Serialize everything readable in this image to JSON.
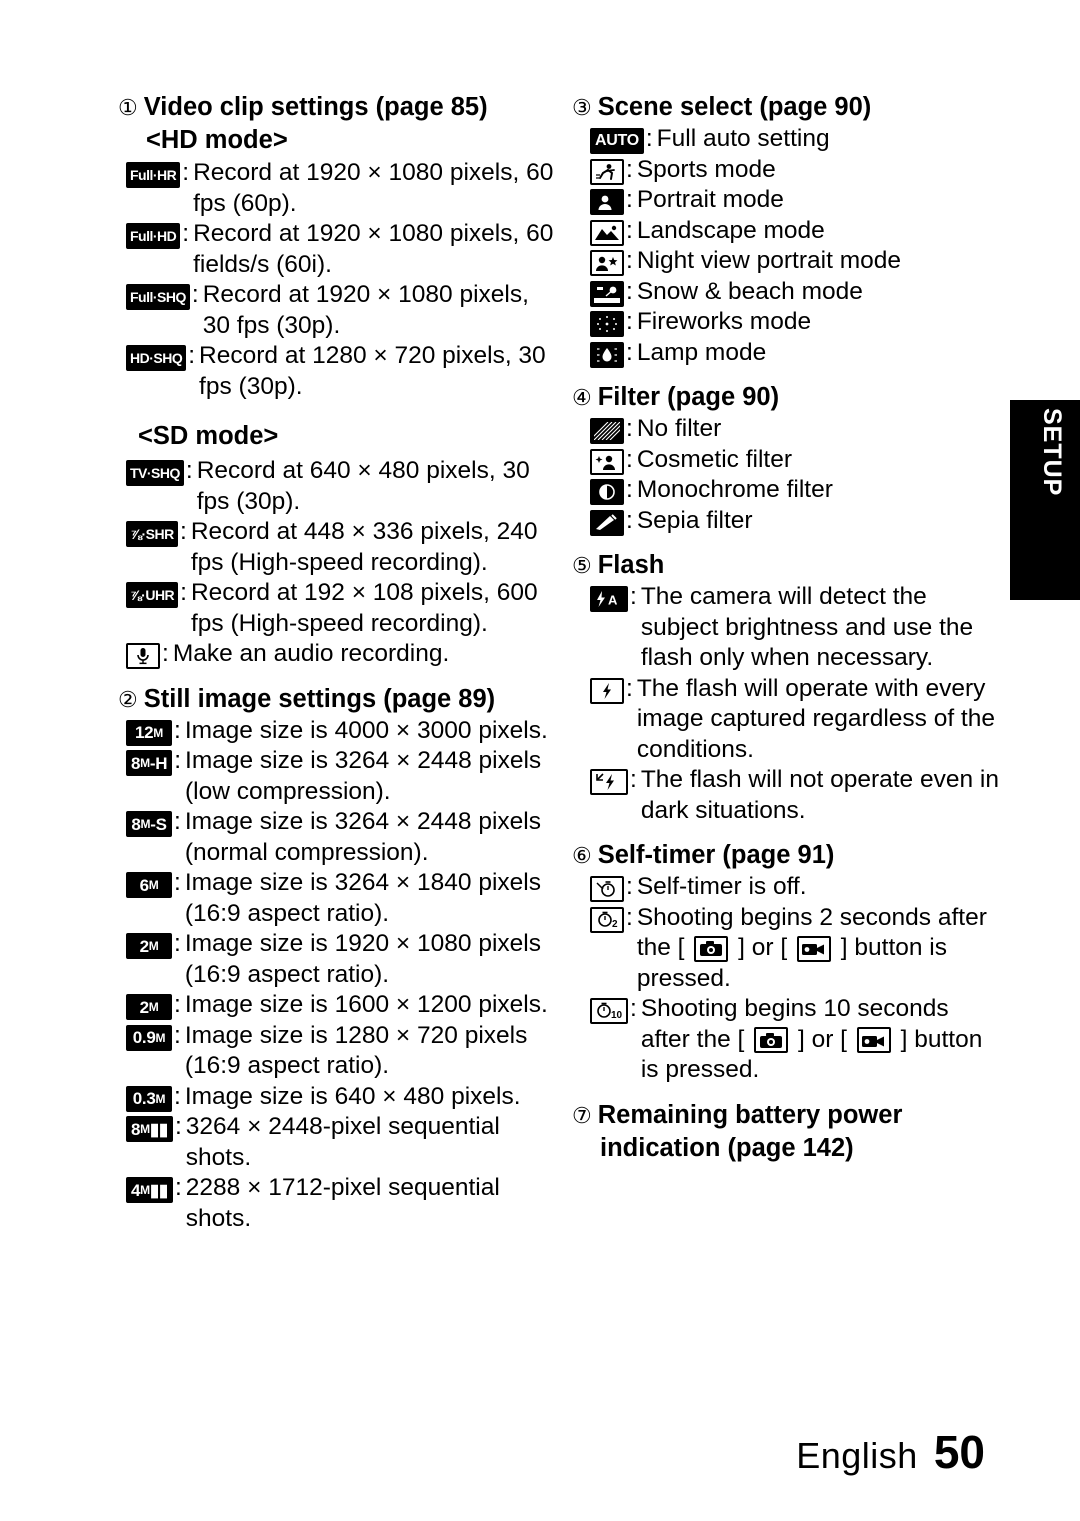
{
  "page": {
    "language": "English",
    "number": "50",
    "side_tab": "SETUP"
  },
  "left_column": {
    "section1": {
      "num": "①",
      "title": "Video clip settings (page 85)",
      "sub_hd": "<HD mode>",
      "hd_items": [
        {
          "icon": "Full-HR",
          "text": "Record at 1920 × 1080 pixels, 60 fps (60p)."
        },
        {
          "icon": "Full-HD",
          "text": "Record at 1920 × 1080 pixels, 60 fields/s (60i)."
        },
        {
          "icon": "Full-SHQ",
          "text": "Record at 1920 × 1080 pixels, 30 fps (30p)."
        },
        {
          "icon": "HD-SHQ",
          "text": "Record at 1280 × 720 pixels, 30 fps (30p)."
        }
      ],
      "sub_sd": "<SD mode>",
      "sd_items": [
        {
          "icon": "TV-SHQ",
          "text": "Record at 640 × 480 pixels, 30 fps (30p)."
        },
        {
          "icon": "Y/6-SHR",
          "text": "Record at 448 × 336 pixels, 240 fps (High-speed recording)."
        },
        {
          "icon": "Y/6-UHR",
          "text": "Record at 192 × 108 pixels, 600 fps (High-speed recording)."
        },
        {
          "icon": "mic",
          "text": "Make an audio recording."
        }
      ]
    },
    "section2": {
      "num": "②",
      "title": "Still image settings (page 89)",
      "items": [
        {
          "icon": "12M",
          "text": "Image size is 4000 × 3000 pixels."
        },
        {
          "icon": "8M-H",
          "text": "Image size is 3264 × 2448 pixels (low compression)."
        },
        {
          "icon": "8M-S",
          "text": "Image size is 3264 × 2448 pixels (normal compression)."
        },
        {
          "icon": "6M",
          "text": "Image size is 3264 × 1840 pixels (16:9 aspect ratio)."
        },
        {
          "icon": "2M-wide",
          "text": "Image size is 1920 × 1080 pixels (16:9 aspect ratio)."
        },
        {
          "icon": "2M",
          "text": "Image size is 1600 × 1200 pixels."
        },
        {
          "icon": "0.9M",
          "text": "Image size is 1280 × 720 pixels (16:9 aspect ratio)."
        },
        {
          "icon": "0.3M",
          "text": "Image size is 640 × 480 pixels."
        },
        {
          "icon": "8M-seq",
          "text": "3264 × 2448-pixel sequential shots."
        },
        {
          "icon": "4M-seq",
          "text": "2288 × 1712-pixel sequential shots."
        }
      ]
    }
  },
  "right_column": {
    "section3": {
      "num": "③",
      "title": "Scene select (page 90)",
      "items": [
        {
          "icon": "AUTO",
          "text": "Full auto setting"
        },
        {
          "icon": "sports",
          "text": "Sports mode"
        },
        {
          "icon": "portrait",
          "text": "Portrait mode"
        },
        {
          "icon": "landscape",
          "text": "Landscape mode"
        },
        {
          "icon": "night-portrait",
          "text": "Night view portrait mode"
        },
        {
          "icon": "snow-beach",
          "text": "Snow & beach mode"
        },
        {
          "icon": "fireworks",
          "text": "Fireworks mode"
        },
        {
          "icon": "lamp",
          "text": "Lamp mode"
        }
      ]
    },
    "section4": {
      "num": "④",
      "title": "Filter (page 90)",
      "items": [
        {
          "icon": "no-filter",
          "text": "No filter"
        },
        {
          "icon": "cosmetic-filter",
          "text": "Cosmetic filter"
        },
        {
          "icon": "monochrome-filter",
          "text": "Monochrome filter"
        },
        {
          "icon": "sepia-filter",
          "text": "Sepia filter"
        }
      ]
    },
    "section5": {
      "num": "⑤",
      "title": "Flash",
      "items": [
        {
          "icon": "flash-auto",
          "text": "The camera will detect the subject brightness and use the flash only when necessary."
        },
        {
          "icon": "flash-on",
          "text": "The flash will operate with every image captured regardless of the conditions."
        },
        {
          "icon": "flash-off",
          "text": "The flash will not operate even in dark situations."
        }
      ]
    },
    "section6": {
      "num": "⑥",
      "title": "Self-timer (page 91)",
      "items": [
        {
          "icon": "timer-off",
          "text": "Self-timer is off."
        },
        {
          "icon": "timer-2s",
          "text_a": "Shooting begins 2 seconds after the [",
          "text_b": "] or [",
          "text_c": "] button is pressed."
        },
        {
          "icon": "timer-10s",
          "text_a": "Shooting begins 10 seconds after the [",
          "text_b": "] or [",
          "text_c": "] button is pressed."
        }
      ]
    },
    "section7": {
      "num": "⑦",
      "title_line1": "Remaining battery power",
      "title_line2": "indication (page 142)"
    }
  }
}
